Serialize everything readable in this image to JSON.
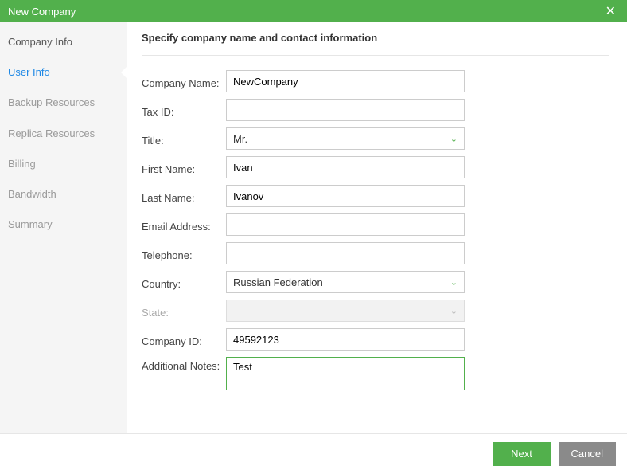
{
  "title": "New Company",
  "heading": "Specify company name and contact information",
  "sidebar": [
    {
      "label": "Company Info",
      "state": "done"
    },
    {
      "label": "User Info",
      "state": "active"
    },
    {
      "label": "Backup Resources",
      "state": "pending"
    },
    {
      "label": "Replica Resources",
      "state": "pending"
    },
    {
      "label": "Billing",
      "state": "pending"
    },
    {
      "label": "Bandwidth",
      "state": "pending"
    },
    {
      "label": "Summary",
      "state": "pending"
    }
  ],
  "form": {
    "company_name": {
      "label": "Company Name:",
      "value": "NewCompany"
    },
    "tax_id": {
      "label": "Tax ID:",
      "value": ""
    },
    "title": {
      "label": "Title:",
      "value": "Mr."
    },
    "first_name": {
      "label": "First Name:",
      "value": "Ivan"
    },
    "last_name": {
      "label": "Last Name:",
      "value": "Ivanov"
    },
    "email": {
      "label": "Email Address:",
      "value": ""
    },
    "telephone": {
      "label": "Telephone:",
      "value": ""
    },
    "country": {
      "label": "Country:",
      "value": "Russian Federation"
    },
    "state": {
      "label": "State:",
      "value": ""
    },
    "company_id": {
      "label": "Company ID:",
      "value": "49592123"
    },
    "notes": {
      "label": "Additional Notes:",
      "value": "Test"
    }
  },
  "buttons": {
    "next": "Next",
    "cancel": "Cancel"
  }
}
